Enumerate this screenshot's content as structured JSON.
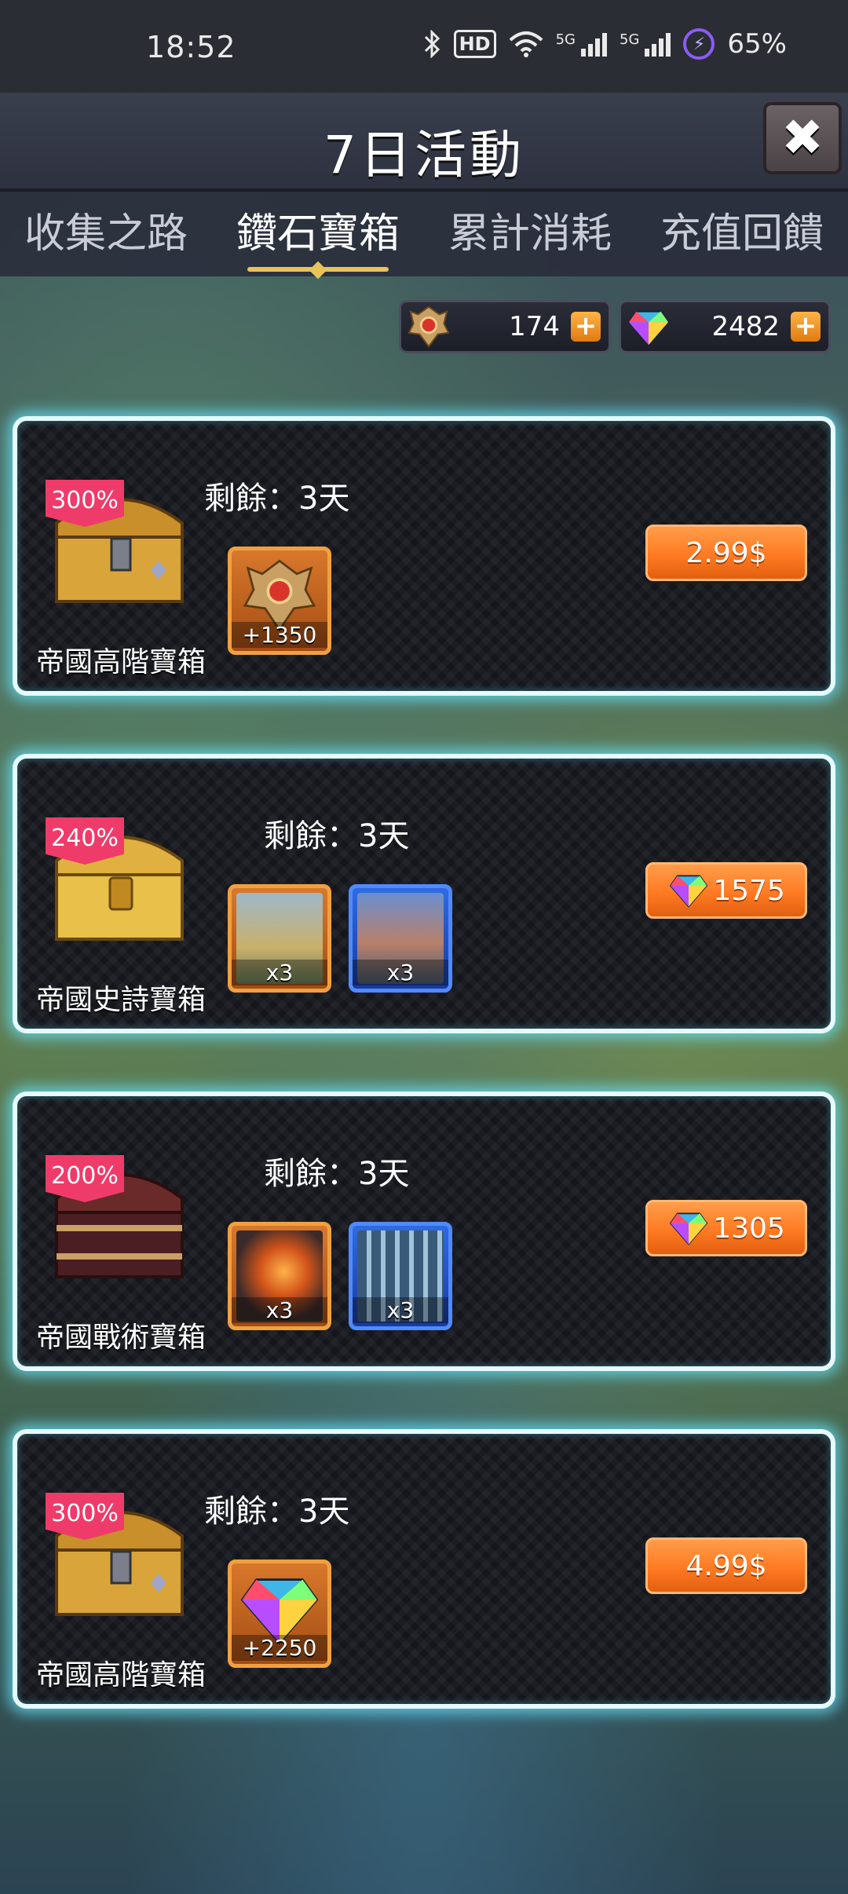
{
  "status_bar": {
    "time": "18:52",
    "hd_label": "HD",
    "signal1": "5G",
    "signal2": "5G",
    "battery": "65%"
  },
  "header": {
    "title": "7日活動",
    "close_symbol": "✖"
  },
  "tabs": [
    {
      "label": "收集之路"
    },
    {
      "label": "鑽石寶箱"
    },
    {
      "label": "累計消耗"
    },
    {
      "label": "充值回饋"
    }
  ],
  "currency": {
    "medals": {
      "value": "174",
      "plus": "+"
    },
    "gems": {
      "value": "2482",
      "plus": "+"
    }
  },
  "packs": [
    {
      "name": "帝國高階寶箱",
      "bonus": "300%",
      "remaining": "剩餘：3天",
      "rewards": [
        {
          "qty": "+1350"
        }
      ],
      "price": "2.99$"
    },
    {
      "name": "帝國史詩寶箱",
      "bonus": "240%",
      "remaining": "剩餘：3天",
      "rewards": [
        {
          "qty": "x3"
        },
        {
          "qty": "x3"
        }
      ],
      "price": "1575"
    },
    {
      "name": "帝國戰術寶箱",
      "bonus": "200%",
      "remaining": "剩餘：3天",
      "rewards": [
        {
          "qty": "x3"
        },
        {
          "qty": "x3"
        }
      ],
      "price": "1305"
    },
    {
      "name": "帝國高階寶箱",
      "bonus": "300%",
      "remaining": "剩餘：3天",
      "rewards": [
        {
          "qty": "+2250"
        }
      ],
      "price": "4.99$"
    }
  ],
  "colors": {
    "badge": "#ef3b6a",
    "price_button": "#ff7a22",
    "glow": "#64e6ff",
    "tab_underline": "#e8c35a"
  }
}
